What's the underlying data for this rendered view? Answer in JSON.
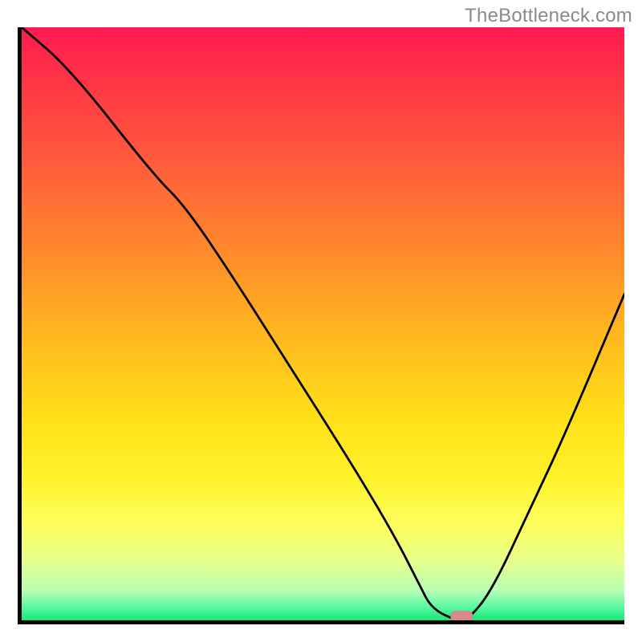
{
  "watermark": "TheBottleneck.com",
  "chart_data": {
    "type": "line",
    "title": "",
    "xlabel": "",
    "ylabel": "",
    "xlim": [
      0,
      100
    ],
    "ylim": [
      0,
      100
    ],
    "grid": false,
    "legend": false,
    "background": {
      "description": "vertical gradient red-orange-yellow-green",
      "stops": [
        {
          "pos": 0,
          "color": "#ff1a52"
        },
        {
          "pos": 22,
          "color": "#ff5a3c"
        },
        {
          "pos": 52,
          "color": "#ffb81f"
        },
        {
          "pos": 76,
          "color": "#fff22a"
        },
        {
          "pos": 95,
          "color": "#b8ffb4"
        },
        {
          "pos": 100,
          "color": "#18e874"
        }
      ]
    },
    "series": [
      {
        "name": "bottleneck-curve",
        "x": [
          0,
          8,
          22,
          27,
          35,
          45,
          55,
          62,
          66,
          68,
          72,
          74,
          78,
          84,
          90,
          100
        ],
        "values": [
          100,
          93,
          75,
          70,
          58,
          42,
          26,
          14,
          6,
          2,
          0,
          0,
          5,
          18,
          31,
          55
        ]
      }
    ],
    "marker": {
      "name": "optimal-point",
      "x": 73,
      "y": 0,
      "shape": "rounded-rect",
      "color": "#d88a8a"
    }
  }
}
